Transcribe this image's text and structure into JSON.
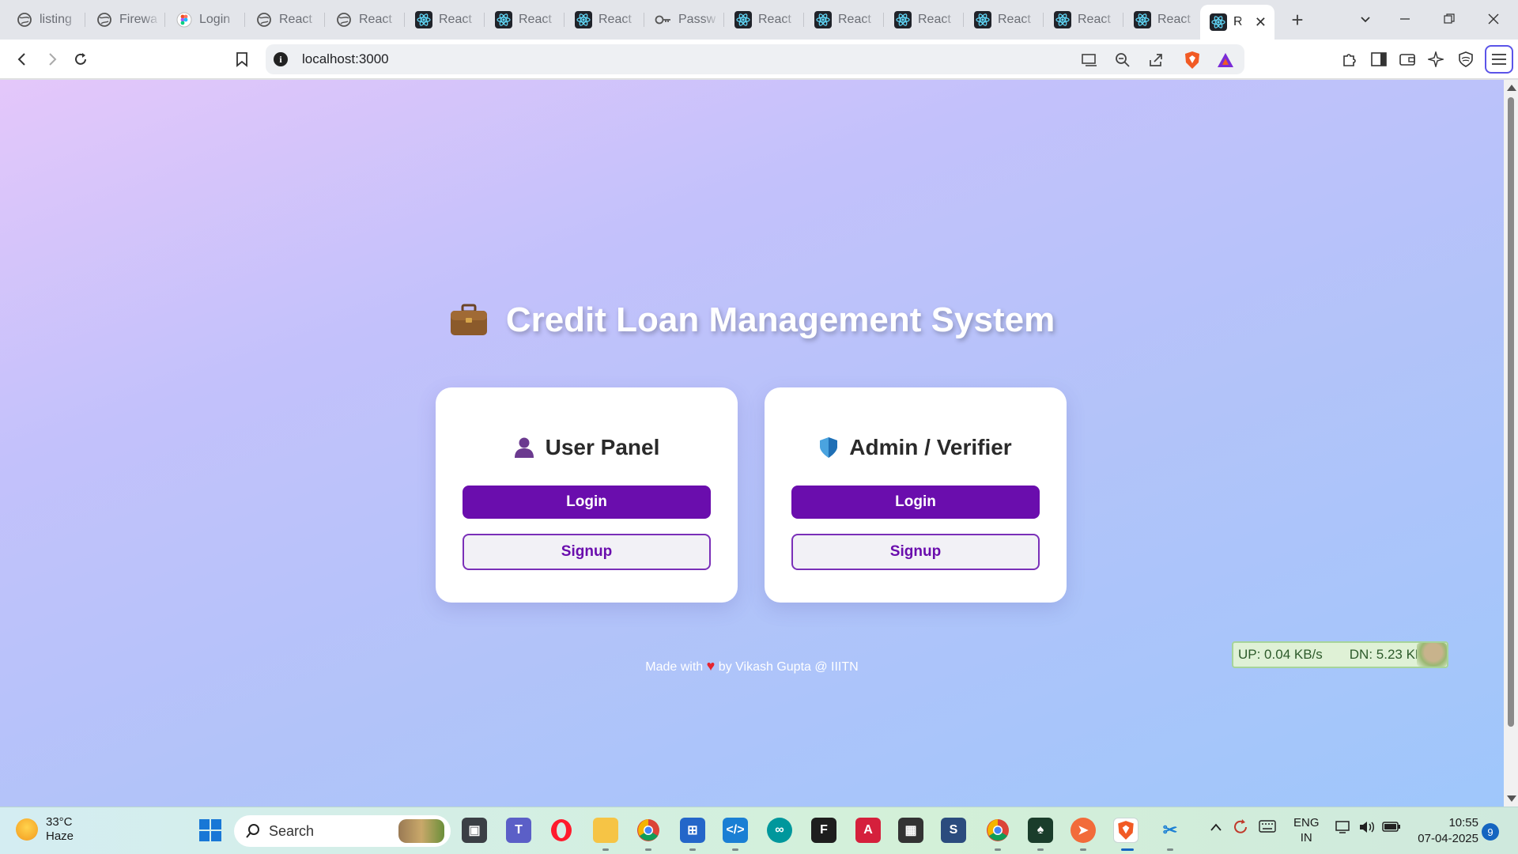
{
  "browser": {
    "tabs": [
      {
        "title": "listing",
        "icon": "globe-icon"
      },
      {
        "title": "Firewa",
        "icon": "globe-icon"
      },
      {
        "title": "Login",
        "icon": "figma-icon"
      },
      {
        "title": "React",
        "icon": "globe-icon"
      },
      {
        "title": "React",
        "icon": "globe-icon"
      },
      {
        "title": "React",
        "icon": "react-icon"
      },
      {
        "title": "React",
        "icon": "react-icon"
      },
      {
        "title": "React",
        "icon": "react-icon"
      },
      {
        "title": "Passw",
        "icon": "key-icon"
      },
      {
        "title": "React",
        "icon": "react-icon"
      },
      {
        "title": "React",
        "icon": "react-icon"
      },
      {
        "title": "React",
        "icon": "react-icon"
      },
      {
        "title": "React",
        "icon": "react-icon"
      },
      {
        "title": "React",
        "icon": "react-icon"
      },
      {
        "title": "React",
        "icon": "react-icon"
      },
      {
        "title": "R",
        "icon": "react-icon",
        "active": true
      }
    ],
    "address_bar": {
      "url": "localhost:3000"
    }
  },
  "page": {
    "title": "Credit Loan Management System",
    "title_icon": "briefcase-icon",
    "user_panel": {
      "title": "User Panel",
      "icon": "user-icon",
      "login_label": "Login",
      "signup_label": "Signup"
    },
    "admin_panel": {
      "title": "Admin / Verifier",
      "icon": "shield-icon",
      "login_label": "Login",
      "signup_label": "Signup"
    },
    "footer": {
      "prefix": "Made with",
      "suffix": "by Vikash Gupta @ IIITN"
    }
  },
  "net_monitor": {
    "up": "UP: 0.04 KB/s",
    "down": "DN: 5.23 KB/s"
  },
  "taskbar": {
    "weather": {
      "temp": "33°C",
      "condition": "Haze"
    },
    "search_placeholder": "Search",
    "language": {
      "line1": "ENG",
      "line2": "IN"
    },
    "clock": {
      "time": "10:55",
      "date": "07-04-2025"
    },
    "notification_count": "9"
  },
  "colors": {
    "primary": "#6a0dad",
    "accent_react": "#1f8ea3"
  }
}
